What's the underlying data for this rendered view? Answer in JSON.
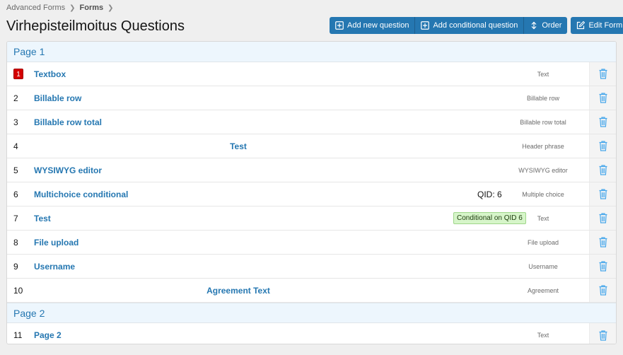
{
  "breadcrumb": {
    "items": [
      "Advanced Forms",
      "Forms"
    ]
  },
  "page": {
    "title": "Virhepisteilmoitus Questions"
  },
  "toolbar": {
    "add_new": "Add new question",
    "add_conditional": "Add conditional question",
    "order": "Order",
    "edit_form": "Edit Form"
  },
  "colors": {
    "accent": "#2577b1",
    "badge": "#d40000",
    "conditional_bg": "#d6f5c9"
  },
  "pages": [
    {
      "title": "Page 1",
      "questions": [
        {
          "num": "1",
          "name": "Textbox",
          "type": "Text",
          "badge": true
        },
        {
          "num": "2",
          "name": "Billable row",
          "type": "Billable row"
        },
        {
          "num": "3",
          "name": "Billable row total",
          "type": "Billable row total"
        },
        {
          "num": "4",
          "name": "Test",
          "type": "Header phrase",
          "centered": true
        },
        {
          "num": "5",
          "name": "WYSIWYG editor",
          "type": "WYSIWYG editor"
        },
        {
          "num": "6",
          "name": "Multichoice conditional",
          "type": "Multiple choice",
          "qid": "QID: 6"
        },
        {
          "num": "7",
          "name": "Test",
          "type": "Text",
          "conditional": "Conditional on QID 6"
        },
        {
          "num": "8",
          "name": "File upload",
          "type": "File upload"
        },
        {
          "num": "9",
          "name": "Username",
          "type": "Username"
        },
        {
          "num": "10",
          "name": "Agreement Text",
          "type": "Agreement",
          "centered": true
        }
      ]
    },
    {
      "title": "Page 2",
      "questions": [
        {
          "num": "11",
          "name": "Page 2",
          "type": "Text"
        }
      ]
    }
  ],
  "icons": {
    "delete": "trash-icon",
    "add": "plus-square-icon",
    "order": "sort-arrows-icon",
    "edit": "edit-icon"
  }
}
